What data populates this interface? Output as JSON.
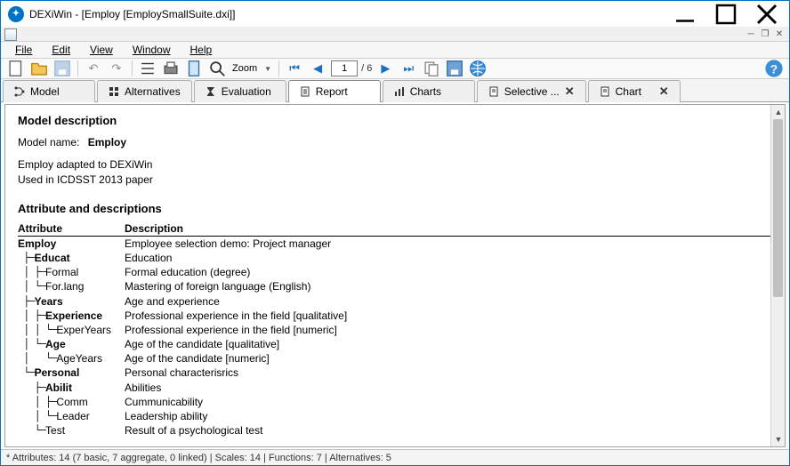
{
  "window": {
    "title": "DEXiWin - [Employ [EmploySmallSuite.dxi]]"
  },
  "menu": {
    "file": "File",
    "edit": "Edit",
    "view": "View",
    "window": "Window",
    "help": "Help"
  },
  "toolbar": {
    "zoom_label": "Zoom",
    "page_current": "1",
    "page_total": "/ 6"
  },
  "tabs": {
    "model": "Model",
    "alternatives": "Alternatives",
    "evaluation": "Evaluation",
    "report": "Report",
    "charts": "Charts",
    "selective": "Selective ...",
    "chart": "Chart"
  },
  "report": {
    "section1_title": "Model description",
    "model_name_label": "Model name:",
    "model_name_value": "Employ",
    "desc_line1": "Employ adapted to DEXiWin",
    "desc_line2": "Used in ICDSST 2013 paper",
    "section2_title": "Attribute and descriptions",
    "col_attr": "Attribute",
    "col_desc": "Description",
    "rows": [
      {
        "tree": "",
        "name": "Employ",
        "bold": true,
        "desc": "Employee selection demo: Project manager"
      },
      {
        "tree": " ├─",
        "name": "Educat",
        "bold": true,
        "desc": "Education"
      },
      {
        "tree": " │ ├─",
        "name": "Formal",
        "bold": false,
        "desc": "Formal education (degree)"
      },
      {
        "tree": " │ └─",
        "name": "For.lang",
        "bold": false,
        "desc": "Mastering of foreign language (English)"
      },
      {
        "tree": " ├─",
        "name": "Years",
        "bold": true,
        "desc": "Age and experience"
      },
      {
        "tree": " │ ├─",
        "name": "Experience",
        "bold": true,
        "desc": "Professional experience in the field [qualitative]"
      },
      {
        "tree": " │ │ └─",
        "name": "ExperYears",
        "bold": false,
        "desc": "Professional experience in the field [numeric]"
      },
      {
        "tree": " │ └─",
        "name": "Age",
        "bold": true,
        "desc": "Age of the candidate [qualitative]"
      },
      {
        "tree": " │   └─",
        "name": "AgeYears",
        "bold": false,
        "desc": "Age of the candidate [numeric]"
      },
      {
        "tree": " └─",
        "name": "Personal",
        "bold": true,
        "desc": "Personal characterisrics"
      },
      {
        "tree": "   ├─",
        "name": "Abilit",
        "bold": true,
        "desc": "Abilities"
      },
      {
        "tree": "   │ ├─",
        "name": "Comm",
        "bold": false,
        "desc": "Cummunicability"
      },
      {
        "tree": "   │ └─",
        "name": "Leader",
        "bold": false,
        "desc": "Leadership ability"
      },
      {
        "tree": "   └─",
        "name": "Test",
        "bold": false,
        "desc": "Result of a psychological test"
      }
    ]
  },
  "statusbar": {
    "text": "* Attributes: 14 (7 basic, 7 aggregate, 0 linked)  |  Scales: 14  |  Functions: 7  |  Alternatives: 5"
  }
}
